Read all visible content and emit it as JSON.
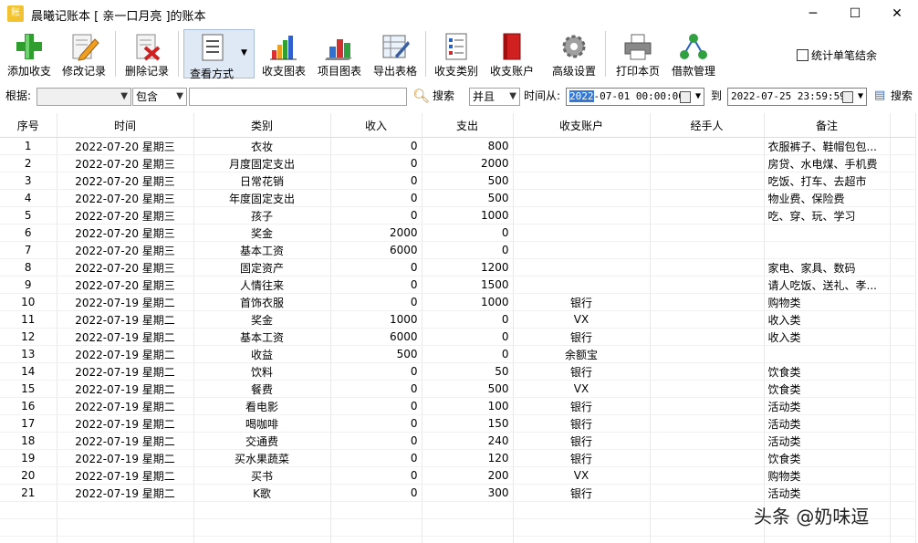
{
  "window": {
    "title": "晨曦记账本  [ 亲一口月亮 ]的账本",
    "app_icon_text": "账",
    "min": "─",
    "max": "☐",
    "close": "✕"
  },
  "toolbar": {
    "add": "添加收支",
    "edit": "修改记录",
    "delete": "删除记录",
    "view": "查看方式",
    "chart": "收支图表",
    "project_chart": "项目图表",
    "export": "导出表格",
    "category": "收支类别",
    "account": "收支账户",
    "advanced": "高级设置",
    "print": "打印本页",
    "loan": "借款管理",
    "single_settle": "统计单笔结余"
  },
  "filter": {
    "basis_label": "根据:",
    "basis_value": "",
    "contains_value": "包含",
    "keyword_value": "",
    "search_label": "搜索",
    "and_value": "并且",
    "time_from_label": "时间从:",
    "time_from_hl": "2022",
    "time_from_rest": "-07-01 00:00:00",
    "to_label": "到",
    "time_to": "2022-07-25 23:59:59",
    "search2_label": "搜索"
  },
  "table": {
    "headers": [
      "序号",
      "时间",
      "类别",
      "收入",
      "支出",
      "收支账户",
      "经手人",
      "备注"
    ],
    "rows": [
      [
        "1",
        "2022-07-20 星期三",
        "衣妆",
        "0",
        "800",
        "",
        "",
        "衣服裤子、鞋帽包包..."
      ],
      [
        "2",
        "2022-07-20 星期三",
        "月度固定支出",
        "0",
        "2000",
        "",
        "",
        "房贷、水电煤、手机费"
      ],
      [
        "3",
        "2022-07-20 星期三",
        "日常花销",
        "0",
        "500",
        "",
        "",
        "吃饭、打车、去超市"
      ],
      [
        "4",
        "2022-07-20 星期三",
        "年度固定支出",
        "0",
        "500",
        "",
        "",
        "物业费、保险费"
      ],
      [
        "5",
        "2022-07-20 星期三",
        "孩子",
        "0",
        "1000",
        "",
        "",
        "吃、穿、玩、学习"
      ],
      [
        "6",
        "2022-07-20 星期三",
        "奖金",
        "2000",
        "0",
        "",
        "",
        ""
      ],
      [
        "7",
        "2022-07-20 星期三",
        "基本工资",
        "6000",
        "0",
        "",
        "",
        ""
      ],
      [
        "8",
        "2022-07-20 星期三",
        "固定资产",
        "0",
        "1200",
        "",
        "",
        "家电、家具、数码"
      ],
      [
        "9",
        "2022-07-20 星期三",
        "人情往来",
        "0",
        "1500",
        "",
        "",
        "请人吃饭、送礼、孝..."
      ],
      [
        "10",
        "2022-07-19 星期二",
        "首饰衣服",
        "0",
        "1000",
        "银行",
        "",
        "购物类"
      ],
      [
        "11",
        "2022-07-19 星期二",
        "奖金",
        "1000",
        "0",
        "VX",
        "",
        "收入类"
      ],
      [
        "12",
        "2022-07-19 星期二",
        "基本工资",
        "6000",
        "0",
        "银行",
        "",
        "收入类"
      ],
      [
        "13",
        "2022-07-19 星期二",
        "收益",
        "500",
        "0",
        "余额宝",
        "",
        ""
      ],
      [
        "14",
        "2022-07-19 星期二",
        "饮料",
        "0",
        "50",
        "银行",
        "",
        "饮食类"
      ],
      [
        "15",
        "2022-07-19 星期二",
        "餐费",
        "0",
        "500",
        "VX",
        "",
        "饮食类"
      ],
      [
        "16",
        "2022-07-19 星期二",
        "看电影",
        "0",
        "100",
        "银行",
        "",
        "活动类"
      ],
      [
        "17",
        "2022-07-19 星期二",
        "喝咖啡",
        "0",
        "150",
        "银行",
        "",
        "活动类"
      ],
      [
        "18",
        "2022-07-19 星期二",
        "交通费",
        "0",
        "240",
        "银行",
        "",
        "活动类"
      ],
      [
        "19",
        "2022-07-19 星期二",
        "买水果蔬菜",
        "0",
        "120",
        "银行",
        "",
        "饮食类"
      ],
      [
        "20",
        "2022-07-19 星期二",
        "买书",
        "0",
        "200",
        "VX",
        "",
        "购物类"
      ],
      [
        "21",
        "2022-07-19 星期二",
        "K歌",
        "0",
        "300",
        "银行",
        "",
        "活动类"
      ]
    ]
  },
  "watermark": "头条 @奶味逗"
}
